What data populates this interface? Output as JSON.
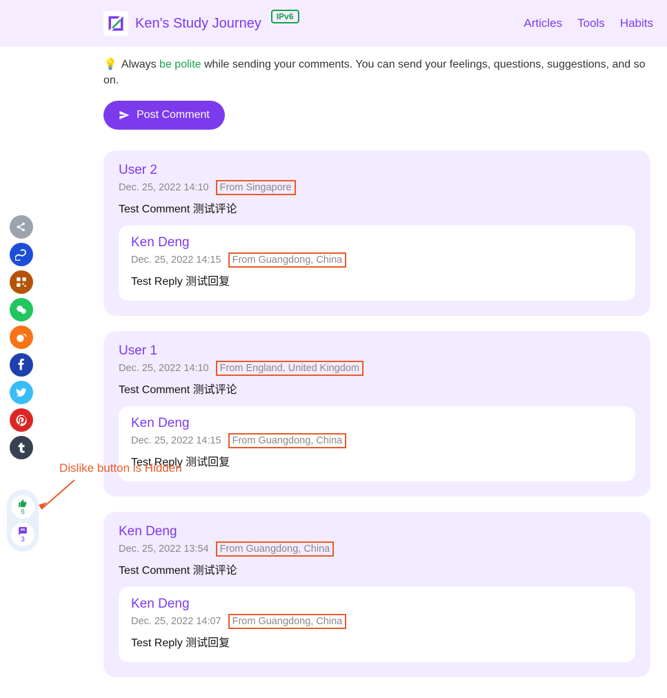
{
  "header": {
    "title": "Ken's Study Journey",
    "badge": "IPv6",
    "nav": [
      "Articles",
      "Tools",
      "Habits"
    ]
  },
  "hint": {
    "prefix": "Always ",
    "green": "be polite",
    "rest": " while sending your comments. You can send your feelings, questions, suggestions, and so on."
  },
  "postButton": "Post Comment",
  "annotation": "Dislike button is Hidden",
  "stats": {
    "likes": "6",
    "comments": "3"
  },
  "comments": [
    {
      "user": "User 2",
      "date": "Dec. 25, 2022 14:10",
      "loc": "From Singapore",
      "body": "Test Comment 测试评论",
      "reply": {
        "user": "Ken Deng",
        "date": "Dec. 25, 2022 14:15",
        "loc": "From Guangdong, China",
        "body": "Test Reply 测试回复"
      }
    },
    {
      "user": "User 1",
      "date": "Dec. 25, 2022 14:10",
      "loc": "From England, United Kingdom",
      "body": "Test Comment 测试评论",
      "reply": {
        "user": "Ken Deng",
        "date": "Dec. 25, 2022 14:15",
        "loc": "From Guangdong, China",
        "body": "Test Reply 测试回复"
      }
    },
    {
      "user": "Ken Deng",
      "date": "Dec. 25, 2022 13:54",
      "loc": "From Guangdong, China",
      "body": "Test Comment 测试评论",
      "reply": {
        "user": "Ken Deng",
        "date": "Dec. 25, 2022 14:07",
        "loc": "From Guangdong, China",
        "body": "Test Reply 测试回复"
      }
    }
  ],
  "sideButtons": [
    {
      "name": "share-icon",
      "bg": "#9ca3af"
    },
    {
      "name": "link-icon",
      "bg": "#1d4ed8"
    },
    {
      "name": "qr-icon",
      "bg": "#b45309"
    },
    {
      "name": "wechat-icon",
      "bg": "#22c55e"
    },
    {
      "name": "weibo-icon",
      "bg": "#f97316"
    },
    {
      "name": "facebook-icon",
      "bg": "#1e40af"
    },
    {
      "name": "twitter-icon",
      "bg": "#38bdf8"
    },
    {
      "name": "pinterest-icon",
      "bg": "#dc2626"
    },
    {
      "name": "tumblr-icon",
      "bg": "#374151"
    }
  ]
}
